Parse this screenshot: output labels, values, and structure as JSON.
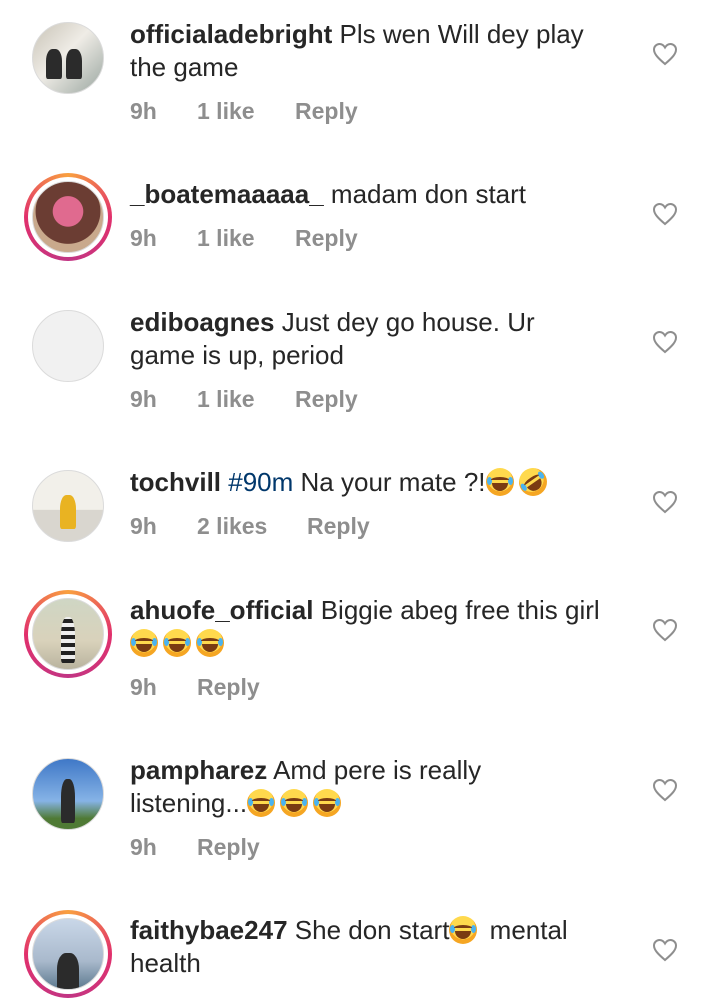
{
  "comments": [
    {
      "username": "officialadebright",
      "text": [
        "Pls wen Will dey play",
        "the game"
      ],
      "time": "9h",
      "likes": "1 like",
      "reply": "Reply"
    },
    {
      "username": "_boatemaaaaa_",
      "text": [
        "madam don start"
      ],
      "time": "9h",
      "likes": "1 like",
      "reply": "Reply"
    },
    {
      "username": "ediboagnes",
      "text": [
        "Just dey go house. Ur",
        "game is up, period"
      ],
      "time": "9h",
      "likes": "1 like",
      "reply": "Reply"
    },
    {
      "username": "tochvill",
      "hashtag": "#90m",
      "text": [
        "Na your mate ?!"
      ],
      "time": "9h",
      "likes": "2 likes",
      "reply": "Reply"
    },
    {
      "username": "ahuofe_official",
      "text": [
        "Biggie abeg free this girl"
      ],
      "time": "9h",
      "reply": "Reply"
    },
    {
      "username": "pampharez",
      "text": [
        "Amd pere is really",
        "listening..."
      ],
      "time": "9h",
      "reply": "Reply"
    },
    {
      "username": "faithybae247",
      "text": [
        "She don start",
        "mental",
        "health"
      ]
    }
  ],
  "icons": {
    "like": "heart-outline-icon",
    "emoji_laugh": "face-with-tears-of-joy-emoji",
    "emoji_rofl": "rolling-on-floor-laughing-emoji"
  },
  "colors": {
    "username": "#262626",
    "meta": "#8e8e8e",
    "hashtag": "#00376b",
    "story_ring": "#e1306c"
  }
}
